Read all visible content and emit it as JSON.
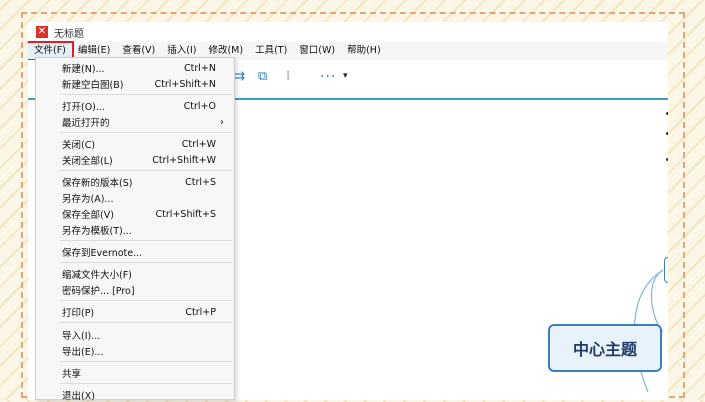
{
  "window": {
    "title": "无标题"
  },
  "menubar": {
    "items": [
      {
        "label": "文件(F)",
        "active": true
      },
      {
        "label": "编辑(E)"
      },
      {
        "label": "查看(V)"
      },
      {
        "label": "插入(I)"
      },
      {
        "label": "修改(M)"
      },
      {
        "label": "工具(T)"
      },
      {
        "label": "窗口(W)"
      },
      {
        "label": "帮助(H)"
      }
    ]
  },
  "file_menu": {
    "items": [
      {
        "label": "新建(N)...",
        "shortcut": "Ctrl+N"
      },
      {
        "label": "新建空白图(B)",
        "shortcut": "Ctrl+Shift+N"
      },
      {
        "label": "打开(O)...",
        "shortcut": "Ctrl+O"
      },
      {
        "label": "最近打开的",
        "submenu": "›"
      },
      {
        "label": "关闭(C)",
        "shortcut": "Ctrl+W"
      },
      {
        "label": "关闭全部(L)",
        "shortcut": "Ctrl+Shift+W"
      },
      {
        "label": "保存新的版本(S)",
        "shortcut": "Ctrl+S"
      },
      {
        "label": "另存为(A)..."
      },
      {
        "label": "保存全部(V)",
        "shortcut": "Ctrl+Shift+S"
      },
      {
        "label": "另存为模板(T)..."
      },
      {
        "label": "保存到Evernote..."
      },
      {
        "label": "缩减文件大小(F)"
      },
      {
        "label": "密码保护... [Pro]"
      },
      {
        "label": "打印(P)",
        "shortcut": "Ctrl+P"
      },
      {
        "label": "导入(I)..."
      },
      {
        "label": "导出(E)..."
      },
      {
        "label": "共享"
      },
      {
        "label": "退出(X)"
      }
    ]
  },
  "toolbar": {
    "more_label": "···",
    "dropdown_glyph": "▾"
  },
  "canvas": {
    "central_topic": "中心主题"
  },
  "colors": {
    "accent": "#3ba0c8",
    "highlight": "#e02020",
    "topic_border": "#3b7fc0"
  }
}
